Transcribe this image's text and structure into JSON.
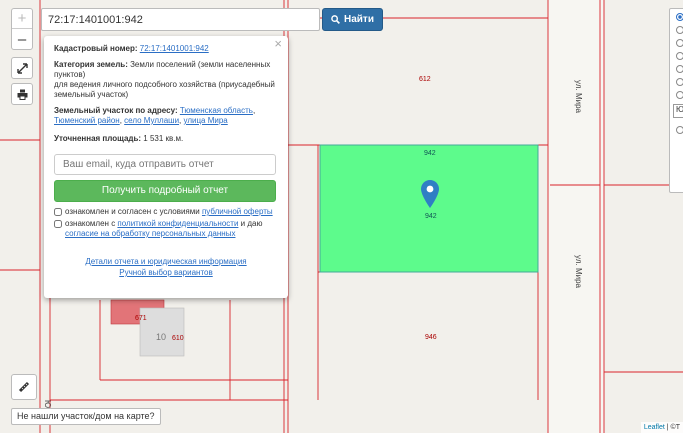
{
  "search": {
    "value": "72:17:1401001:942",
    "button_label": "Найти"
  },
  "zoom": {
    "in_label": "+",
    "out_label": "–"
  },
  "popup": {
    "cadastral_label": "Кадастровый номер:",
    "cadastral_number": "72:17:1401001:942",
    "category_label": "Категория земель:",
    "category_value": "Земли поселений (земли населенных пунктов)",
    "usage_value": "для ведения личного подсобного хозяйства (приусадебный земельный участок)",
    "address_label": "Земельный участок по адресу:",
    "address_region": "Тюменская область",
    "address_district": "Тюменский район",
    "address_village": "село Муллаши",
    "address_street": "улица Мира",
    "area_label": "Уточненная площадь:",
    "area_value": "1 531 кв.м.",
    "email_placeholder": "Ваш email, куда отправить отчет",
    "get_report_label": "Получить подробный отчет",
    "consent1_text": "ознакомлен и согласен с условиями ",
    "consent1_link": "публичной оферты",
    "consent2_text": "ознакомлен с ",
    "consent2_link1": "политикой конфиденциальности",
    "consent2_mid": " и даю ",
    "consent2_link2": "согласие на обработку персональных данных",
    "details_link": "Детали отчета и юридическая информация",
    "manual_link": "Ручной выбор вариантов"
  },
  "map": {
    "parcel_612": "612",
    "parcel_942_top": "942",
    "parcel_942_center": "942",
    "parcel_946": "946",
    "parcel_610": "610",
    "parcel_671": "671",
    "house_10": "10",
    "street_mira_1": "ул. Мира",
    "street_mira_2": "ул. Мира",
    "street_yubil": "Юбил",
    "highlight_color": "#5dfb8c"
  },
  "not_found_label": "Не нашли участок/дом на карте?",
  "attribution": {
    "leaflet": "Leaflet",
    "sep": " | ©T"
  },
  "right_panel": {
    "select_text": "Ю"
  }
}
